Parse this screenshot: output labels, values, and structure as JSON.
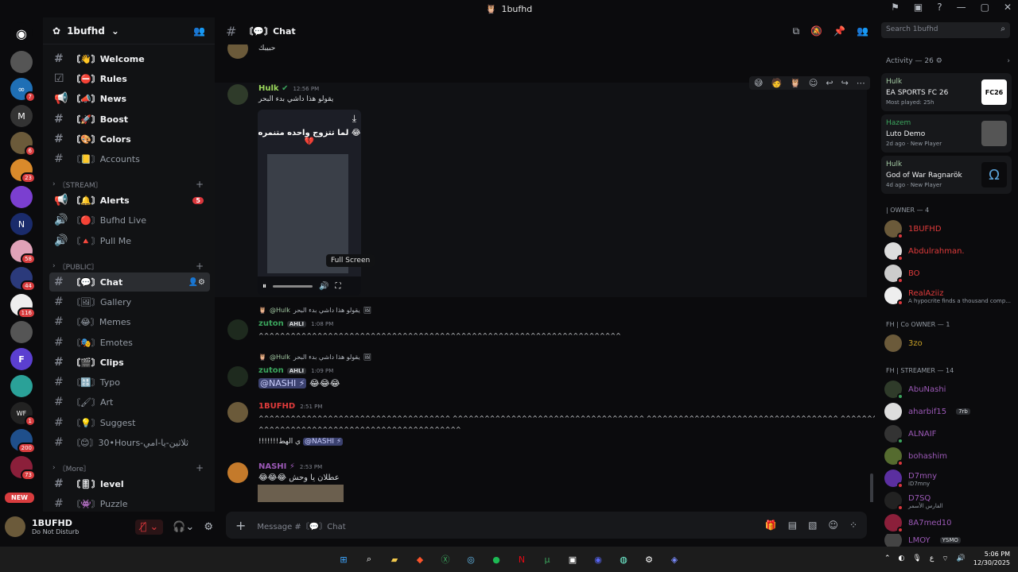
{
  "window": {
    "title": "1bufhd"
  },
  "servers": [
    {
      "badge": ""
    },
    {
      "badge": "7"
    },
    {
      "badge": ""
    },
    {
      "badge": "6"
    },
    {
      "badge": "23"
    },
    {
      "badge": ""
    },
    {
      "badge": ""
    },
    {
      "badge": "58"
    },
    {
      "badge": "44"
    },
    {
      "badge": "116"
    },
    {
      "badge": ""
    },
    {
      "badge": ""
    },
    {
      "badge": ""
    },
    {
      "badge": "1"
    },
    {
      "badge": "200"
    },
    {
      "badge": "73"
    }
  ],
  "server_new_label": "NEW",
  "guild": {
    "name": "1bufhd"
  },
  "channels": [
    {
      "label": "〘👋〙Welcome"
    },
    {
      "label": "〘⛔〙Rules"
    },
    {
      "label": "〘📣〙News"
    },
    {
      "label": "〘🚀〙Boost"
    },
    {
      "label": "〘🎨〙Colors"
    },
    {
      "label": "〘📒〙Accounts"
    },
    {
      "label": "〘🔔〙Alerts",
      "count": "5"
    },
    {
      "label": "〘🔴〙Bufhd Live"
    },
    {
      "label": "〘🔺〙Pull Me"
    },
    {
      "label": "〘💬〙Chat"
    },
    {
      "label": "〘🖼〙Gallery"
    },
    {
      "label": "〘😂〙Memes"
    },
    {
      "label": "〘🎭〙Emotes"
    },
    {
      "label": "〘🎬〙Clips"
    },
    {
      "label": "〘🔠〙Typo"
    },
    {
      "label": "〘🖌〙Art"
    },
    {
      "label": "〘💡〙Suggest"
    },
    {
      "label": "〘😊〙30•Hours-ثلاثين-يا-امي"
    },
    {
      "label": "〘🎚〙level"
    },
    {
      "label": "〘👾〙Puzzle"
    }
  ],
  "categories": {
    "stream": "〘STREAM〙",
    "public": "〘PUBLIC〙",
    "more": "〘More〙"
  },
  "user": {
    "name": "1BUFHD",
    "status": "Do Not Disturb"
  },
  "chat": {
    "channel": "〘💬〙Chat",
    "top_text": "حبيبك",
    "hulk": {
      "name": "Hulk",
      "time": "12:56 PM",
      "text": "يقولو هذا داشي بدء البحر"
    },
    "video": {
      "caption": "لما تتزوج واحده متنمره 😂💔",
      "tooltip": "Full Screen"
    },
    "m1": {
      "reply_user": "@Hulk",
      "reply_text": "يقولو هذا داشي بدء البحر",
      "name": "zuton",
      "tag": "AHLI",
      "time": "1:08 PM",
      "text": "^^^^^^^^^^^^^^^^^^^^^^^^^^^^^^^^^^^^^^^^^^^^^^^^^^^^^^^^^^^^^^^^^^^^"
    },
    "m2": {
      "reply_user": "@Hulk",
      "reply_text": "يقولو هذا داشي بدء البحر",
      "name": "zuton",
      "tag": "AHLI",
      "time": "1:09 PM",
      "mention": "@NASHI ⚡",
      "text": "😂😂😂"
    },
    "m3": {
      "name": "1BUFHD",
      "time": "2:51 PM",
      "line1": "^^^^^^^^^^^^^^^^^^^^^^^^^^^^^^^^^^^^ ^^^^^^^^^^^^^^^^^^^^^^^^^^^^^^^^^^^^ ^^^^^^^^^^^^^^^^^^^^^^^^^^^^^^^^^^^^ ^^^^^^^^^^^^^^^^^^^^^^^^^^^^^^^^^^^^",
      "line2": "^^^^^^^^^^^^^^^^^^^^^^^^^^^^^^^^^^^^^^",
      "line3": "!!!!!!!ي الهط",
      "mention": "@NASHI ⚡"
    },
    "m4": {
      "name": "NASHI ⚡",
      "time": "2:53 PM",
      "text": "😂😂😂 عطلان يا وحش"
    },
    "composer_placeholder": "Message #〘💬〙Chat"
  },
  "right": {
    "search_placeholder": "Search 1bufhd",
    "activity_header": "Activity — 26",
    "cards": [
      {
        "who": "Hulk",
        "game": "EA SPORTS FC 26",
        "meta": "Most played: 25h",
        "art": "FC26"
      },
      {
        "who": "Hazem",
        "game": "Luto Demo",
        "meta": "2d ago · New Player",
        "art": ""
      },
      {
        "who": "Hulk",
        "game": "God of War Ragnarök",
        "meta": "4d ago · New Player",
        "art": "Ω"
      }
    ],
    "sections": [
      "| OWNER — 4",
      "FH | Co OWNER — 1",
      "FH | STREAMER — 14"
    ],
    "members": [
      {
        "name": "1BUFHD",
        "sub": "",
        "color": "#e03b3b"
      },
      {
        "name": "Abdulrahman.",
        "sub": "",
        "color": "#e03b3b"
      },
      {
        "name": "BO",
        "sub": "",
        "color": "#e03b3b"
      },
      {
        "name": "RealAziiz",
        "sub": "A hypocrite finds a thousand comp...",
        "color": "#e03b3b"
      },
      {
        "name": "3zo",
        "sub": "",
        "color": "#c9a227"
      },
      {
        "name": "AbuNashi",
        "sub": "",
        "color": "#9b59b6"
      },
      {
        "name": "aharbif15",
        "sub": "",
        "color": "#9b59b6",
        "tag": "7rb"
      },
      {
        "name": "ALNAIF",
        "sub": "",
        "color": "#9b59b6"
      },
      {
        "name": "bohashim",
        "sub": "",
        "color": "#9b59b6"
      },
      {
        "name": "D7mny",
        "sub": "iD7mny",
        "color": "#9b59b6"
      },
      {
        "name": "D7SQ",
        "sub": "الفارس الأسمر",
        "color": "#9b59b6"
      },
      {
        "name": "8A7med10",
        "sub": "",
        "color": "#9b59b6"
      },
      {
        "name": "LMOY",
        "sub": "",
        "color": "#9b59b6",
        "tag": "YSMO"
      }
    ]
  },
  "taskbar": {
    "time": "5:06 PM",
    "date": "12/30/2025",
    "lang": "ع"
  }
}
